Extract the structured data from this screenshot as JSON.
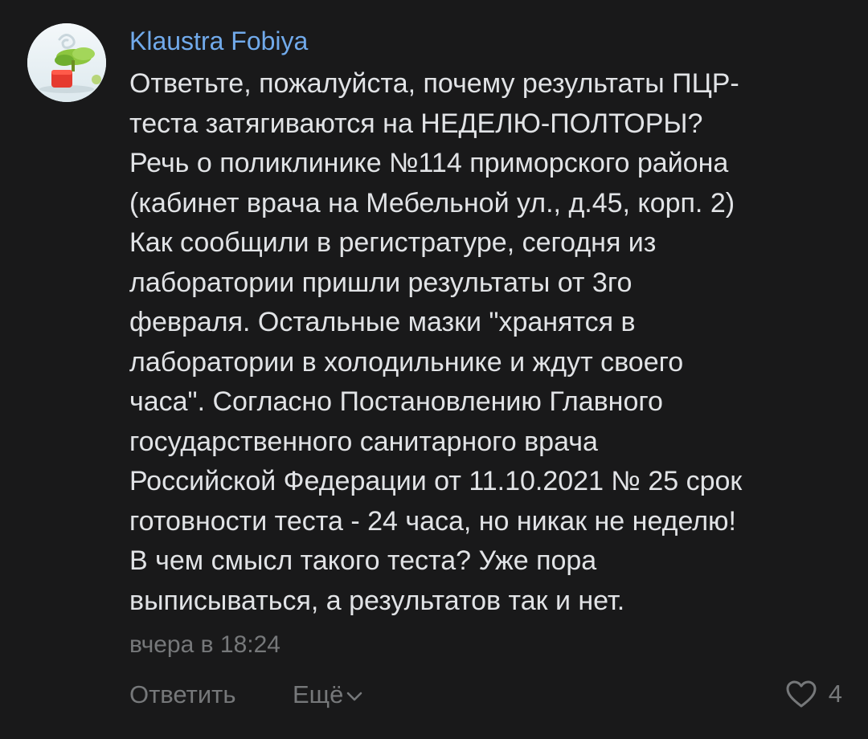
{
  "comment": {
    "author": "Klaustra Fobiya",
    "avatar_icon": "avatar-image",
    "text_lines": [
      "Ответьте, пожалуйста, почему результаты ПЦР-",
      "теста затягиваются на НЕДЕЛЮ-ПОЛТОРЫ?",
      "Речь о поликлинике №114 приморского района",
      "(кабинет врача на Мебельной ул., д.45, корп. 2)",
      "Как сообщили в регистратуре, сегодня из",
      "лаборатории пришли результаты от 3го",
      "февраля. Остальные мазки \"хранятся в",
      "лаборатории в холодильнике и ждут своего",
      "часа\". Согласно Постановлению Главного",
      "государственного санитарного врача",
      "Российской Федерации от 11.10.2021 № 25 срок",
      "готовности теста - 24 часа, но никак не неделю!",
      "В чем смысл такого теста? Уже пора",
      "выписываться, а результатов так и нет."
    ],
    "timestamp": "вчера в 18:24"
  },
  "actions": {
    "reply_label": "Ответить",
    "more_label": "Ещё",
    "more_icon": "chevron-down-icon",
    "like_icon": "heart-outline-icon",
    "like_count": "4"
  },
  "colors": {
    "background": "#19191a",
    "author": "#71aaeb",
    "text": "#e1e3e6",
    "secondary": "#76787a"
  }
}
